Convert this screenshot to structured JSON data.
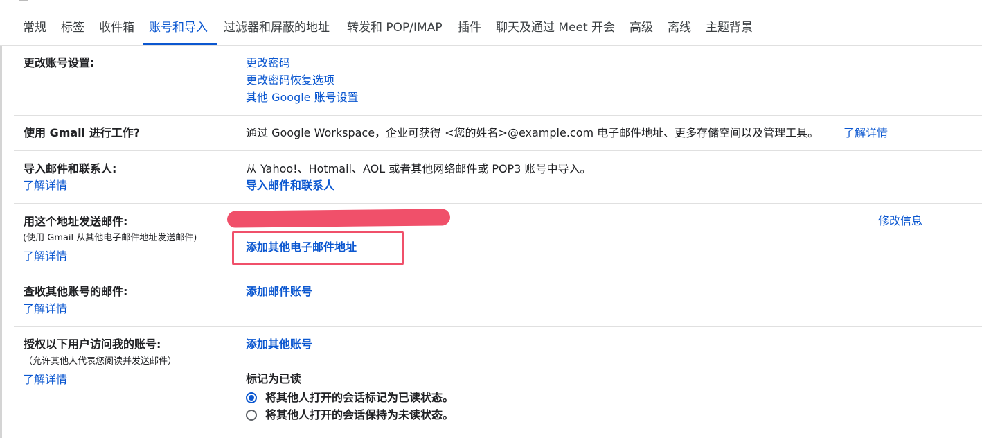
{
  "tabs": [
    {
      "label": "常规"
    },
    {
      "label": "标签"
    },
    {
      "label": "收件箱"
    },
    {
      "label": "账号和导入",
      "active": true
    },
    {
      "label": "过滤器和屏蔽的地址"
    },
    {
      "label": "转发和 POP/IMAP"
    },
    {
      "label": "插件"
    },
    {
      "label": "聊天及通过 Meet 开会"
    },
    {
      "label": "高级"
    },
    {
      "label": "离线"
    },
    {
      "label": "主题背景"
    }
  ],
  "sections": {
    "change_account": {
      "label": "更改账号设置:",
      "links": [
        "更改密码",
        "更改密码恢复选项",
        "其他 Google 账号设置"
      ]
    },
    "workspace": {
      "label": "使用 Gmail 进行工作?",
      "text": "通过 Google Workspace，企业可获得 <您的姓名>@example.com 电子邮件地址、更多存储空间以及管理工具。",
      "link": "了解详情"
    },
    "import": {
      "label": "导入邮件和联系人:",
      "learn_more": "了解详情",
      "text": "从 Yahoo!、Hotmail、AOL 或者其他网络邮件或 POP3 账号中导入。",
      "action": "导入邮件和联系人"
    },
    "send_as": {
      "label": "用这个地址发送邮件:",
      "sublabel": "(使用 Gmail 从其他电子邮件地址发送邮件)",
      "learn_more": "了解详情",
      "edit": "修改信息",
      "action": "添加其他电子邮件地址"
    },
    "check_mail": {
      "label": "查收其他账号的邮件:",
      "learn_more": "了解详情",
      "action": "添加邮件账号"
    },
    "delegate": {
      "label": "授权以下用户访问我的账号:",
      "sublabel": "（允许其他人代表您阅读并发送邮件）",
      "learn_more": "了解详情",
      "action": "添加其他账号",
      "mark_read_title": "标记为已读",
      "options": [
        {
          "label": "将其他人打开的会话标记为已读状态。",
          "checked": true
        },
        {
          "label": "将其他人打开的会话保持为未读状态。",
          "checked": false
        }
      ]
    }
  },
  "colors": {
    "accent": "#0b57d0",
    "highlight": "#f0506a"
  }
}
